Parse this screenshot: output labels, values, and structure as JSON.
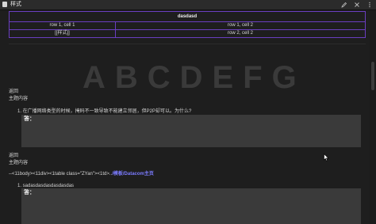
{
  "window": {
    "title": "样式"
  },
  "table": {
    "header": "dasdasd",
    "rows": [
      [
        "row 1, cell 1",
        "row 1, cell 2"
      ],
      [
        "[[样式]]",
        "row 2, cell 2"
      ]
    ]
  },
  "banner": {
    "letters": "ABCDEFG"
  },
  "section1": {
    "back": "返回",
    "subtitle": "主题内容",
    "question": "1. 在广播网络类型的时候，掩码不一致导致不能建立邻居，但P2P却可以。为什么?",
    "answer_label": "答："
  },
  "section2": {
    "back": "返回",
    "subtitle": "主题内容",
    "code_prefix": "--<11body><11div><1table class=\"ZYan\"><1td>..",
    "code_link": "/模板/Datacom主页",
    "question": "1. sadasdasdasdasdasdas",
    "answer_label": "答："
  },
  "colors": {
    "background": "#1e1e1e",
    "table_border": "#6a3ec0",
    "answer_box": "#3a3a3a",
    "link": "#7b7bff"
  }
}
